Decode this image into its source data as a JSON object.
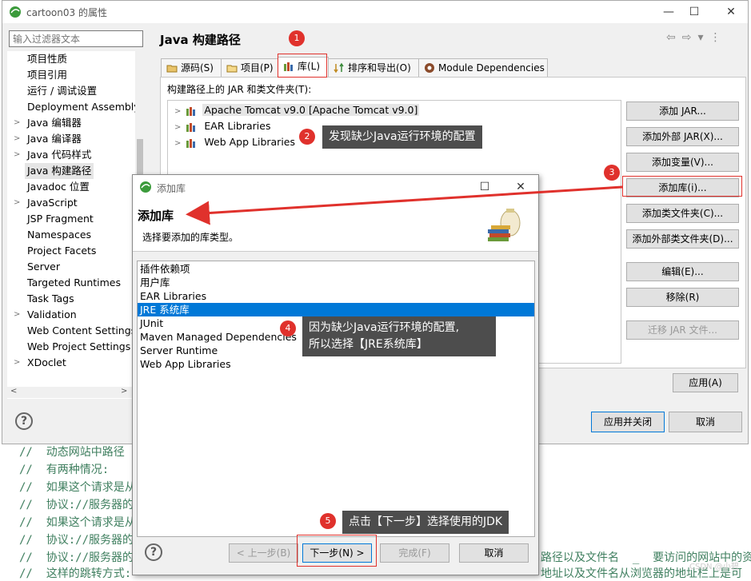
{
  "window": {
    "title": "cartoon03 的属性"
  },
  "filter": {
    "placeholder": "输入过滤器文本"
  },
  "sidebar": {
    "items": [
      {
        "label": "项目性质",
        "arrow": ""
      },
      {
        "label": "项目引用",
        "arrow": ""
      },
      {
        "label": "运行 / 调试设置",
        "arrow": ""
      },
      {
        "label": "Deployment Assembly",
        "arrow": ""
      },
      {
        "label": "Java 编辑器",
        "arrow": ">"
      },
      {
        "label": "Java 编译器",
        "arrow": ">"
      },
      {
        "label": "Java 代码样式",
        "arrow": ">"
      },
      {
        "label": "Java 构建路径",
        "arrow": ""
      },
      {
        "label": "Javadoc 位置",
        "arrow": ""
      },
      {
        "label": "JavaScript",
        "arrow": ">"
      },
      {
        "label": "JSP Fragment",
        "arrow": ""
      },
      {
        "label": "Namespaces",
        "arrow": ""
      },
      {
        "label": "Project Facets",
        "arrow": ""
      },
      {
        "label": "Server",
        "arrow": ""
      },
      {
        "label": "Targeted Runtimes",
        "arrow": ""
      },
      {
        "label": "Task Tags",
        "arrow": ""
      },
      {
        "label": "Validation",
        "arrow": ">"
      },
      {
        "label": "Web Content Settings",
        "arrow": ""
      },
      {
        "label": "Web Project Settings",
        "arrow": ""
      },
      {
        "label": "XDoclet",
        "arrow": ">"
      }
    ],
    "selected_index": 7
  },
  "main": {
    "title": "Java 构建路径",
    "tabs": [
      {
        "label": "源码(S)"
      },
      {
        "label": "项目(P)"
      },
      {
        "label": "库(L)"
      },
      {
        "label": "排序和导出(O)"
      },
      {
        "label": "Module Dependencies"
      }
    ],
    "panel_label": "构建路径上的 JAR 和类文件夹(T):",
    "libraries": [
      {
        "label": "Apache Tomcat v9.0 [Apache Tomcat v9.0]"
      },
      {
        "label": "EAR Libraries"
      },
      {
        "label": "Web App Libraries"
      }
    ],
    "buttons": {
      "add_jar": "添加 JAR...",
      "add_external_jar": "添加外部 JAR(X)...",
      "add_variable": "添加变量(V)...",
      "add_library": "添加库(i)...",
      "add_class_folder": "添加类文件夹(C)...",
      "add_external_class_folder": "添加外部类文件夹(D)...",
      "edit": "编辑(E)...",
      "remove": "移除(R)",
      "migrate_jar": "迁移 JAR 文件..."
    },
    "apply": "应用(A)",
    "apply_close": "应用并关闭",
    "cancel": "取消"
  },
  "dialog": {
    "title": "添加库",
    "heading": "添加库",
    "subtitle": "选择要添加的库类型。",
    "items": [
      "插件依赖项",
      "用户库",
      "EAR Libraries",
      "JRE 系统库",
      "JUnit",
      "Maven Managed Dependencies",
      "Server Runtime",
      "Web App Libraries"
    ],
    "selected_index": 3,
    "buttons": {
      "back": "< 上一步(B)",
      "next": "下一步(N) >",
      "finish": "完成(F)",
      "cancel": "取消"
    }
  },
  "callouts": {
    "c2": "发现缺少Java运行环境的配置",
    "c4_line1": "因为缺少Java运行环境的配置,",
    "c4_line2": "所以选择【JRE系统库】",
    "c5": "点击【下一步】选择使用的JDK"
  },
  "badges": {
    "n1": "1",
    "n2": "2",
    "n3": "3",
    "n4": "4",
    "n5": "5"
  },
  "code": {
    "lines": [
      "//  动态网站中路径",
      "//  有两种情况:",
      "//  如果这个请求是从",
      "//  协议://服务器的",
      "//  如果这个请求是从",
      "//  协议://服务器的",
      "//  协议://服务器的",
      "//  这样的跳转方式:"
    ],
    "right1": "路径以及文件名  _  要访问的网站中的资",
    "right2": "地址以及文件名从浏览器的地址栏上是可"
  },
  "watermark": "CSDN @小碧",
  "colors": {
    "accent": "#0078d7",
    "annotation": "#e0312c",
    "callout_bg": "#4d4d4d",
    "comment": "#3f7f5f"
  }
}
